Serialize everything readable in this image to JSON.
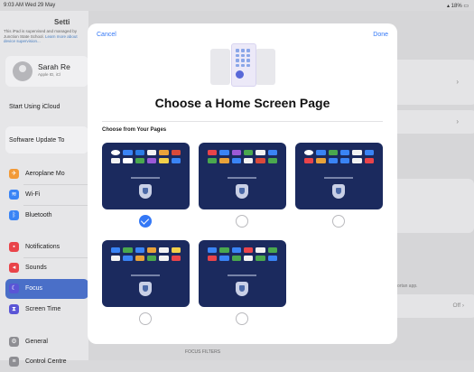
{
  "status_bar": {
    "time": "9:03 AM  Wed 29 May",
    "battery": "▴ 18% ▭"
  },
  "background": {
    "sidebar_title": "Setti",
    "note": "This iPad is supervised and managed by Junction State School.",
    "note_link": "Learn more about device supervision...",
    "profile": {
      "name": "Sarah Re",
      "subtitle": "Apple ID, iCl"
    },
    "start_icloud": "Start Using iCloud",
    "software_update": "Software Update To",
    "items": [
      {
        "label": "Aeroplane Mo",
        "icon": "airplane-icon",
        "color": "#f29a38"
      },
      {
        "label": "Wi-Fi",
        "icon": "wifi-icon",
        "color": "#3a84f5"
      },
      {
        "label": "Bluetooth",
        "icon": "bluetooth-icon",
        "color": "#3a84f5"
      },
      {
        "label": "Notifications",
        "icon": "bell-icon",
        "color": "#e9444a"
      },
      {
        "label": "Sounds",
        "icon": "speaker-icon",
        "color": "#e9444a"
      },
      {
        "label": "Focus",
        "icon": "moon-icon",
        "color": "#5a55d6"
      },
      {
        "label": "Screen Time",
        "icon": "hourglass-icon",
        "color": "#5a55d6"
      },
      {
        "label": "General",
        "icon": "gear-icon",
        "color": "#8e8e93"
      },
      {
        "label": "Control Centre",
        "icon": "switches-icon",
        "color": "#8e8e93"
      }
    ],
    "main_off_value": "Off",
    "main_note": "ortan app.",
    "focus_filters": "FOCUS FILTERS"
  },
  "modal": {
    "cancel": "Cancel",
    "done": "Done",
    "title": "Choose a Home Screen Page",
    "section": "Choose from Your Pages",
    "pages": [
      {
        "selected": true
      },
      {
        "selected": false
      },
      {
        "selected": false
      },
      {
        "selected": false
      },
      {
        "selected": false
      }
    ]
  },
  "colors": {
    "accent": "#3478f6",
    "page_bg": "#1b2a5e",
    "focus_selected": "#4a6fc8"
  }
}
